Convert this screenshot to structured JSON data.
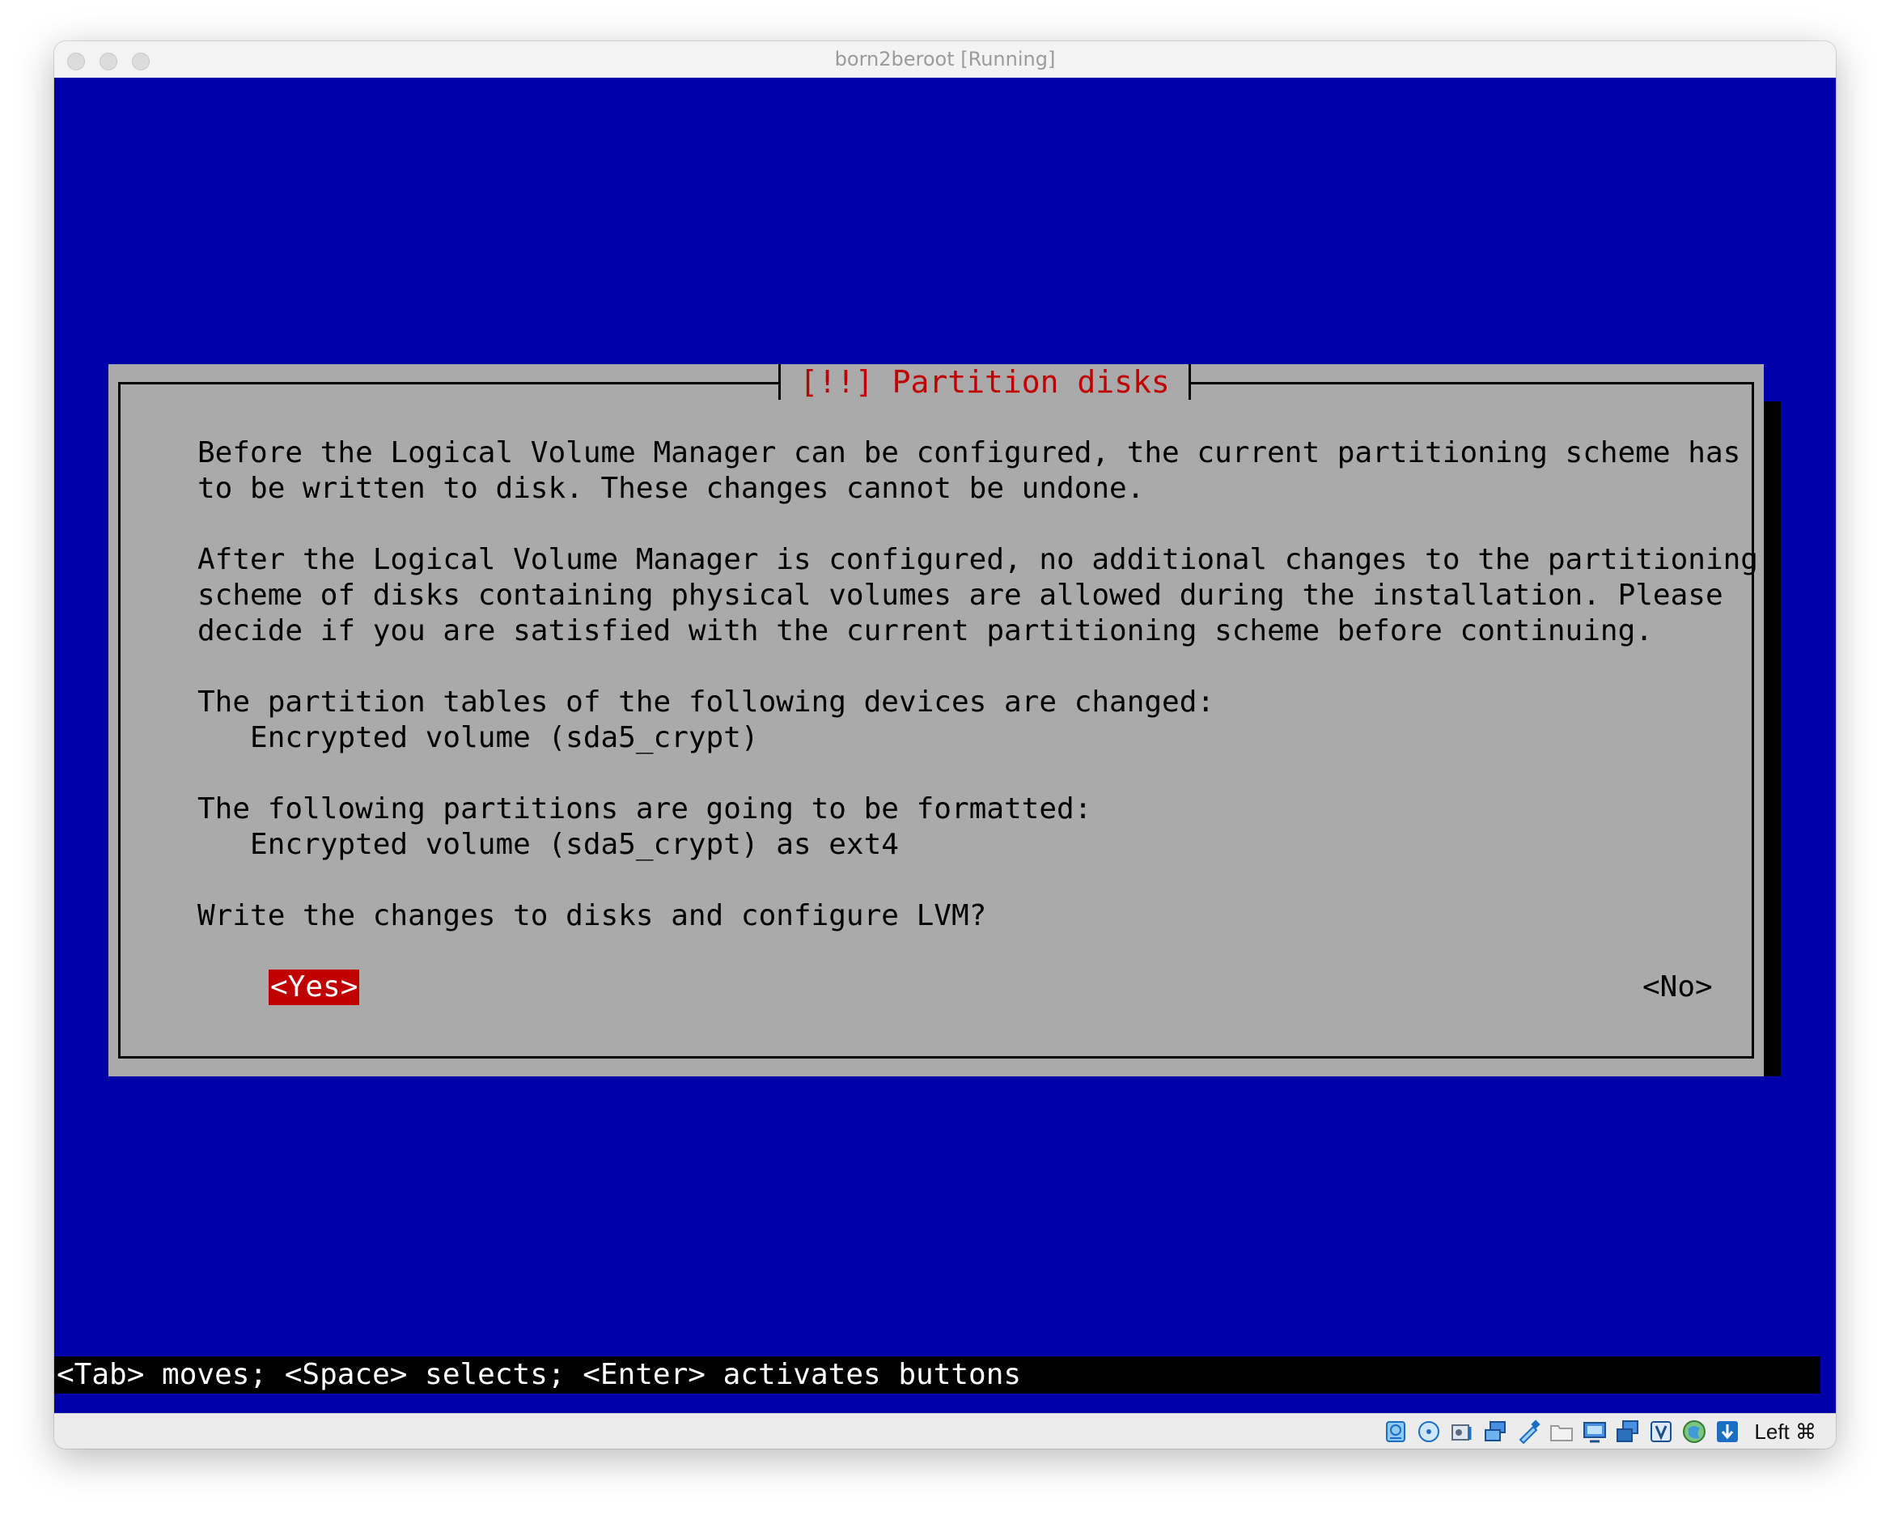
{
  "window": {
    "title": "born2beroot [Running]"
  },
  "dialog": {
    "title": " [!!] Partition disks ",
    "lines": [
      "Before the Logical Volume Manager can be configured, the current partitioning scheme has",
      "to be written to disk. These changes cannot be undone.",
      "After the Logical Volume Manager is configured, no additional changes to the partitioning",
      "scheme of disks containing physical volumes are allowed during the installation. Please",
      "decide if you are satisfied with the current partitioning scheme before continuing.",
      "The partition tables of the following devices are changed:",
      "   Encrypted volume (sda5_crypt)",
      "The following partitions are going to be formatted:",
      "   Encrypted volume (sda5_crypt) as ext4",
      "Write the changes to disks and configure LVM?"
    ],
    "yes_label": "<Yes>",
    "no_label": "<No>"
  },
  "help_text": "<Tab> moves; <Space> selects; <Enter> activates buttons",
  "statusbar": {
    "host_key": "Left ⌘",
    "icons": [
      "hard-disk-icon",
      "optical-drive-icon",
      "audio-icon",
      "network-icon",
      "usb-icon",
      "shared-folders-icon",
      "display-icon",
      "video-capture-icon",
      "vrde-icon",
      "recording-icon",
      "mouse-integration-icon"
    ]
  },
  "colors": {
    "screen_bg": "#0000a8",
    "dialog_bg": "#aaaaaa",
    "accent_red": "#c00000"
  }
}
